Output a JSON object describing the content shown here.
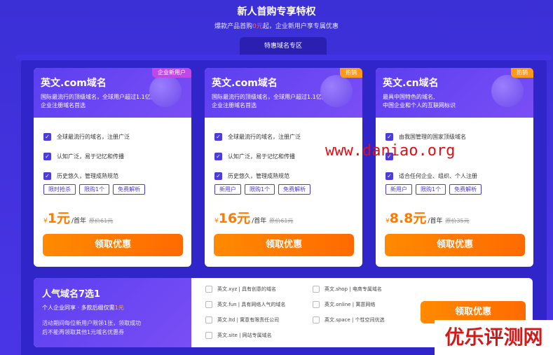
{
  "header": {
    "title": "新人首购专享特权",
    "sub_a": "爆款产品首购",
    "sub_b": "0元",
    "sub_c": "起，企业新用户享专属优惠"
  },
  "tab": "特惠域名专区",
  "cards": [
    {
      "title": "英文.com域名",
      "desc1": "国际最流行的顶级域名，全球用户超过1.1亿,",
      "desc2": "企业注册域名首选",
      "badge": "企业新用户",
      "features": [
        "全球最流行的域名，注册广泛",
        "认知广泛，易于记忆和传播",
        "历史悠久，管理成熟规范"
      ],
      "tags": [
        "限时抢杀",
        "限购1个",
        "免费解析"
      ],
      "yen": "¥",
      "price": "1元",
      "unit": "/首年",
      "orig": "原价61元",
      "button": "领取优惠"
    },
    {
      "title": "英文.com域名",
      "desc1": "国际最流行的顶级域名，全球用户超过1.1亿,",
      "desc2": "企业注册域名首选",
      "badge": "热销",
      "features": [
        "全球最流行的域名，注册广泛",
        "认知广泛，易于记忆和传播",
        "历史悠久，管理成熟规范"
      ],
      "tags": [
        "新用户",
        "限购1个",
        "免费解析"
      ],
      "yen": "¥",
      "price": "16元",
      "unit": "/首年",
      "orig": "原价61元",
      "button": "领取优惠"
    },
    {
      "title": "英文.cn域名",
      "desc1": "最具中国特色的域名,",
      "desc2": "中国企业和个人的互联网标识",
      "badge": "热销",
      "features": [
        "由我国管理的国家顶级域名",
        "",
        "适合任何企业、组织、个人注册"
      ],
      "tags": [
        "新用户",
        "限购1个",
        "免费解析"
      ],
      "yen": "¥",
      "price": "8.8元",
      "unit": "/首年",
      "orig": "原价35元",
      "button": "领取优惠"
    }
  ],
  "bottom": {
    "title": "人气域名7选1",
    "sub_a": "个人企业同享 · 多款后缀仅需",
    "sub_b": "1元",
    "note1": "活动期间每位新用户限领1张，领取成功",
    "note2": "后不能再领取其他1元域名优惠券",
    "options": [
      "英文.xyz | 具有创意的域名",
      "英文.shop | 电商专属域名",
      "英文.fun | 具有网络人气的域名",
      "英文.online | 寓意网络",
      "英文.ltd | 寓意有限责任公司",
      "英文.space | 个性空间优选",
      "英文.site | 网站专属域名"
    ],
    "button": "领取优惠"
  },
  "watermark1": "www.daniao.org",
  "watermark2": "优乐评测网"
}
